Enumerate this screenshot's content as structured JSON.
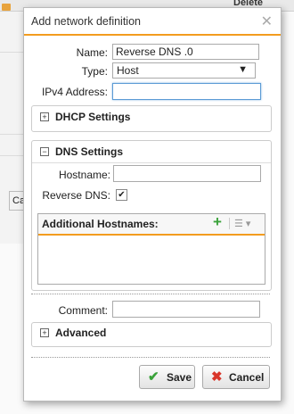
{
  "background": {
    "delete_label": "Delete",
    "ca_label": "Ca"
  },
  "dialog": {
    "title": "Add network definition",
    "close_icon": "close-icon",
    "name_label": "Name:",
    "name_value": "Reverse DNS .0",
    "type_label": "Type:",
    "type_value": "Host",
    "ipv4_label": "IPv4 Address:",
    "ipv4_value": "",
    "dhcp_section": {
      "title": "DHCP Settings",
      "toggle": "+"
    },
    "dns_section": {
      "title": "DNS Settings",
      "toggle": "−",
      "hostname_label": "Hostname:",
      "hostname_value": "",
      "reverse_dns_label": "Reverse DNS:",
      "reverse_dns_checked": "✔",
      "additional_hostnames": {
        "title": "Additional Hostnames:",
        "add_icon": "+"
      }
    },
    "comment_label": "Comment:",
    "comment_value": "",
    "advanced_section": {
      "title": "Advanced",
      "toggle": "+"
    },
    "save_label": "Save",
    "cancel_label": "Cancel",
    "colors": {
      "accent": "#f39c1f",
      "save_icon": "#3aa23a",
      "cancel_icon": "#d9362b"
    }
  }
}
